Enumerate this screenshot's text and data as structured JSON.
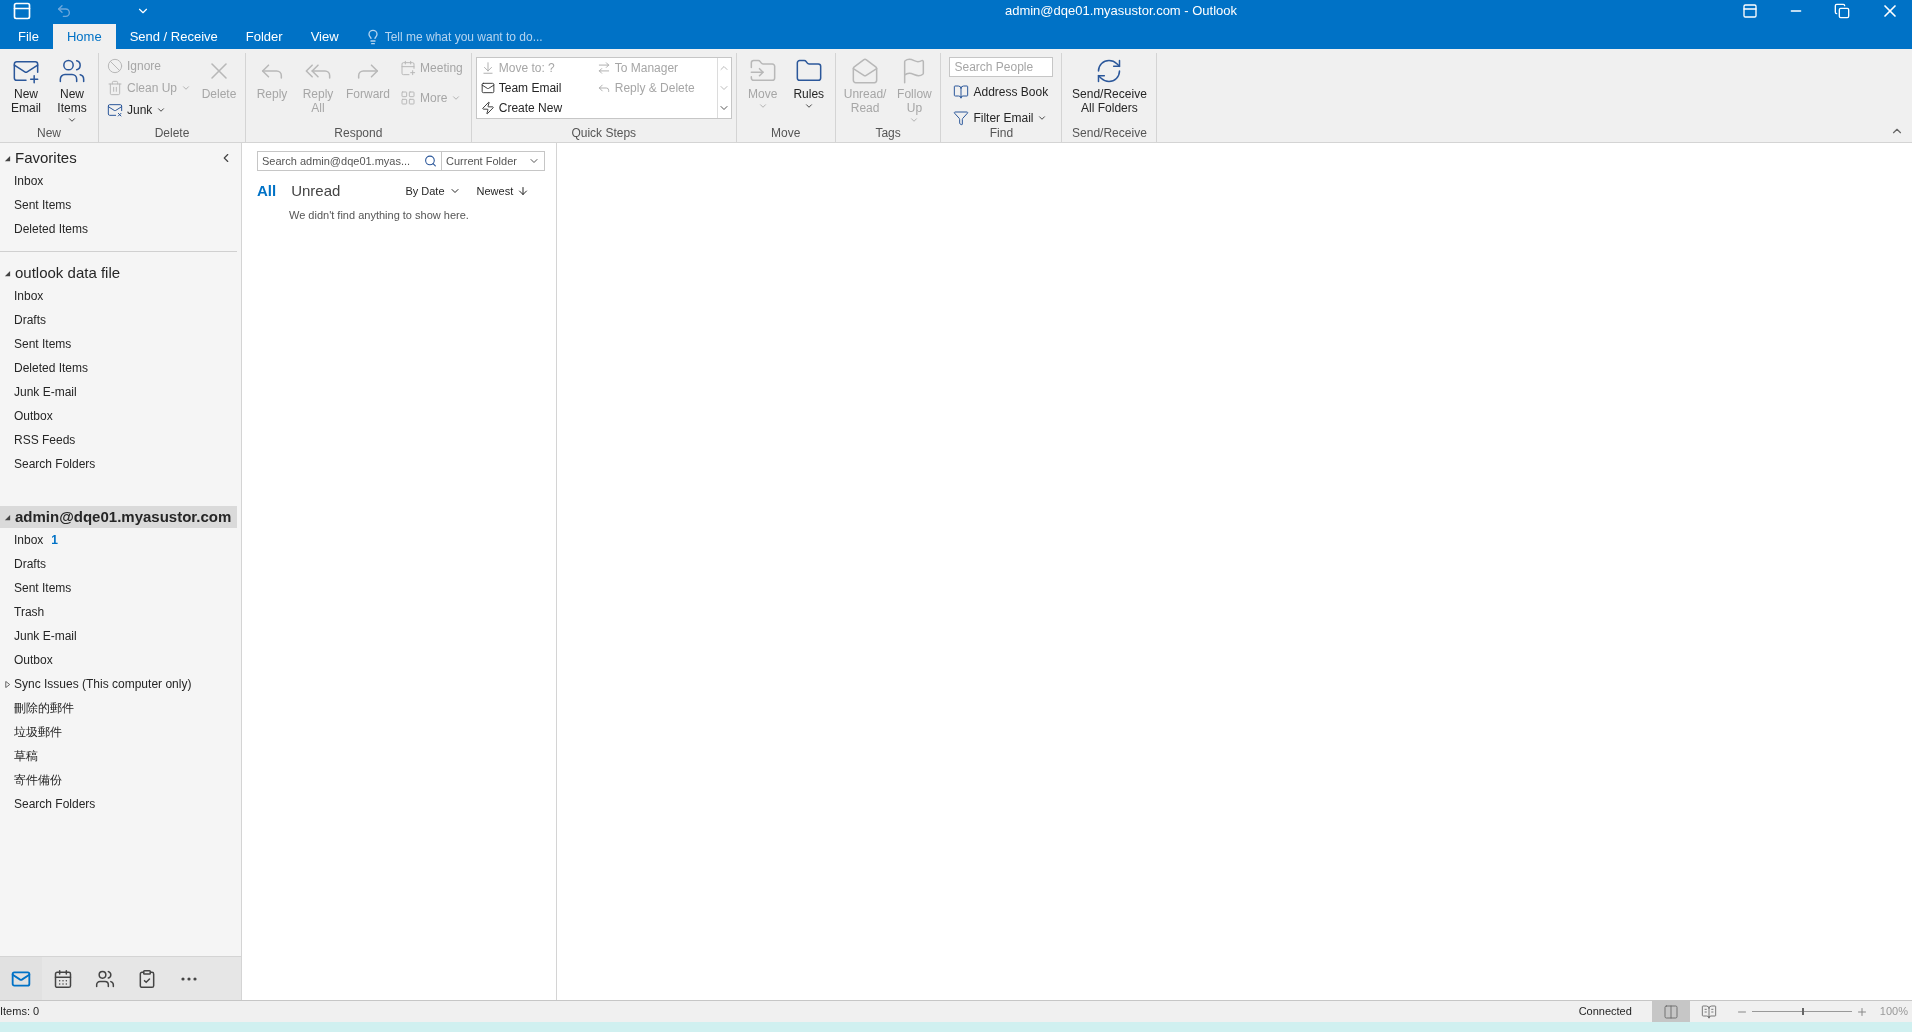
{
  "window": {
    "title": "admin@dqe01.myasustor.com - Outlook"
  },
  "tabs": [
    {
      "label": "File",
      "selected": false
    },
    {
      "label": "Home",
      "selected": true
    },
    {
      "label": "Send / Receive",
      "selected": false
    },
    {
      "label": "Folder",
      "selected": false
    },
    {
      "label": "View",
      "selected": false
    }
  ],
  "tell_me": {
    "placeholder": "Tell me what you want to do..."
  },
  "ribbon": [
    {
      "name": "New",
      "kind": "buttons",
      "items": [
        {
          "kind": "large",
          "label": "New Email",
          "disabled": false,
          "dropdown": false
        },
        {
          "kind": "large",
          "label": "New Items",
          "disabled": false,
          "dropdown": true
        }
      ]
    },
    {
      "name": "Delete",
      "kind": "buttons",
      "items": [
        {
          "kind": "small",
          "label": "Ignore",
          "disabled": true,
          "dropdown": false
        },
        {
          "kind": "small",
          "label": "Clean Up",
          "disabled": true,
          "dropdown": true
        },
        {
          "kind": "small",
          "label": "Junk",
          "disabled": false,
          "dropdown": true
        },
        {
          "kind": "large",
          "label": "Delete",
          "disabled": true,
          "dropdown": false
        }
      ]
    },
    {
      "name": "Respond",
      "kind": "buttons",
      "items": [
        {
          "kind": "large",
          "label": "Reply",
          "disabled": true,
          "dropdown": false
        },
        {
          "kind": "large",
          "label": "Reply All",
          "disabled": true,
          "dropdown": false
        },
        {
          "kind": "large",
          "label": "Forward",
          "disabled": true,
          "dropdown": false
        },
        {
          "kind": "small",
          "label": "Meeting",
          "disabled": true,
          "dropdown": false
        },
        {
          "kind": "small",
          "label": "More",
          "disabled": true,
          "dropdown": true
        }
      ]
    },
    {
      "name": "Quick Steps",
      "kind": "gallery",
      "items": [
        {
          "label": "Move to: ?",
          "disabled": true
        },
        {
          "label": "To Manager",
          "disabled": true
        },
        {
          "label": "Team Email",
          "disabled": false
        },
        {
          "label": "Reply & Delete",
          "disabled": true
        },
        {
          "label": "Create New",
          "disabled": false
        }
      ]
    },
    {
      "name": "Move",
      "kind": "buttons",
      "items": [
        {
          "kind": "large",
          "label": "Move",
          "disabled": true,
          "dropdown": true
        },
        {
          "kind": "large",
          "label": "Rules",
          "disabled": false,
          "dropdown": true
        }
      ]
    },
    {
      "name": "Tags",
      "kind": "buttons",
      "items": [
        {
          "kind": "large",
          "label": "Unread/ Read",
          "disabled": true,
          "dropdown": false
        },
        {
          "kind": "large",
          "label": "Follow Up",
          "disabled": true,
          "dropdown": true
        }
      ]
    },
    {
      "name": "Find",
      "kind": "find",
      "search": {
        "placeholder": "Search People"
      },
      "items": [
        {
          "kind": "small",
          "label": "Address Book",
          "disabled": false,
          "dropdown": false
        },
        {
          "kind": "small",
          "label": "Filter Email",
          "disabled": false,
          "dropdown": true
        }
      ]
    },
    {
      "name": "Send/Receive",
      "kind": "buttons",
      "items": [
        {
          "kind": "large",
          "label": "Send/Receive All Folders",
          "disabled": false,
          "dropdown": false
        }
      ]
    }
  ],
  "sidebar": {
    "sections": [
      {
        "name": "Favorites",
        "kind": "favorites",
        "expanded": true,
        "selected": false,
        "folders": [
          {
            "kind": "folder",
            "name": "Inbox"
          },
          {
            "kind": "folder",
            "name": "Sent Items"
          },
          {
            "kind": "folder",
            "name": "Deleted Items"
          }
        ]
      },
      {
        "name": "outlook data file",
        "kind": "store",
        "expanded": true,
        "selected": false,
        "folders": [
          {
            "kind": "folder",
            "name": "Inbox"
          },
          {
            "kind": "folder",
            "name": "Drafts"
          },
          {
            "kind": "folder",
            "name": "Sent Items"
          },
          {
            "kind": "folder",
            "name": "Deleted Items"
          },
          {
            "kind": "folder",
            "name": "Junk E-mail"
          },
          {
            "kind": "folder",
            "name": "Outbox"
          },
          {
            "kind": "folder",
            "name": "RSS Feeds"
          },
          {
            "kind": "folder",
            "name": "Search Folders"
          }
        ]
      },
      {
        "name": "admin@dqe01.myasustor.com",
        "kind": "account",
        "expanded": true,
        "selected": true,
        "folders": [
          {
            "kind": "folder",
            "name": "Inbox",
            "count": "1"
          },
          {
            "kind": "folder",
            "name": "Drafts"
          },
          {
            "kind": "folder",
            "name": "Sent Items"
          },
          {
            "kind": "folder",
            "name": "Trash"
          },
          {
            "kind": "folder",
            "name": "Junk E-mail"
          },
          {
            "kind": "folder",
            "name": "Outbox"
          },
          {
            "kind": "group",
            "name": "Sync Issues (This computer only)",
            "expanded": false
          },
          {
            "kind": "folder",
            "name": "刪除的郵件"
          },
          {
            "kind": "folder",
            "name": "垃圾郵件"
          },
          {
            "kind": "folder",
            "name": "草稿"
          },
          {
            "kind": "folder",
            "name": "寄件備份"
          },
          {
            "kind": "folder",
            "name": "Search Folders"
          }
        ]
      }
    ]
  },
  "nav": [
    {
      "selected": true
    },
    {
      "selected": false
    },
    {
      "selected": false
    },
    {
      "selected": false
    },
    {
      "selected": false
    }
  ],
  "message_list": {
    "search": {
      "placeholder": "Search admin@dqe01.myas..."
    },
    "scope": "Current Folder",
    "filters": [
      {
        "label": "All",
        "selected": true
      },
      {
        "label": "Unread",
        "selected": false
      }
    ],
    "sort": "By Date",
    "order": "Newest",
    "empty_text": "We didn't find anything to show here."
  },
  "status_bar": {
    "items": "Items: 0",
    "connection": "Connected",
    "views": [
      {
        "selected": true
      },
      {
        "selected": false
      }
    ],
    "zoom": {
      "level": 0.5,
      "reading": "100%"
    }
  }
}
